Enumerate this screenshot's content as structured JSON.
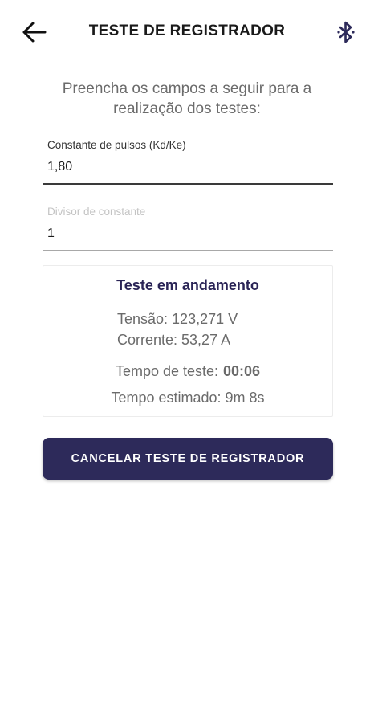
{
  "header": {
    "title": "TESTE DE REGISTRADOR",
    "back_icon": "arrow-left-icon",
    "bluetooth_icon": "bluetooth-icon"
  },
  "instructions": "Preencha os campos a seguir para a realização dos testes:",
  "fields": {
    "constant": {
      "label": "Constante de pulsos (Kd/Ke)",
      "value": "1,80"
    },
    "divisor": {
      "label": "Divisor de constante",
      "value": "1"
    }
  },
  "progress": {
    "title": "Teste em andamento",
    "tension": "Tensão: 123,271 V",
    "current": "Corrente: 53,27 A",
    "time_label": "Tempo de teste:",
    "time_value": "00:06",
    "estimate": "Tempo estimado: 9m 8s"
  },
  "actions": {
    "cancel_label": "CANCELAR TESTE DE REGISTRADOR"
  },
  "colors": {
    "primary": "#2d2a5a",
    "card_title": "#2a2456",
    "muted_text": "#6b6b6b"
  }
}
